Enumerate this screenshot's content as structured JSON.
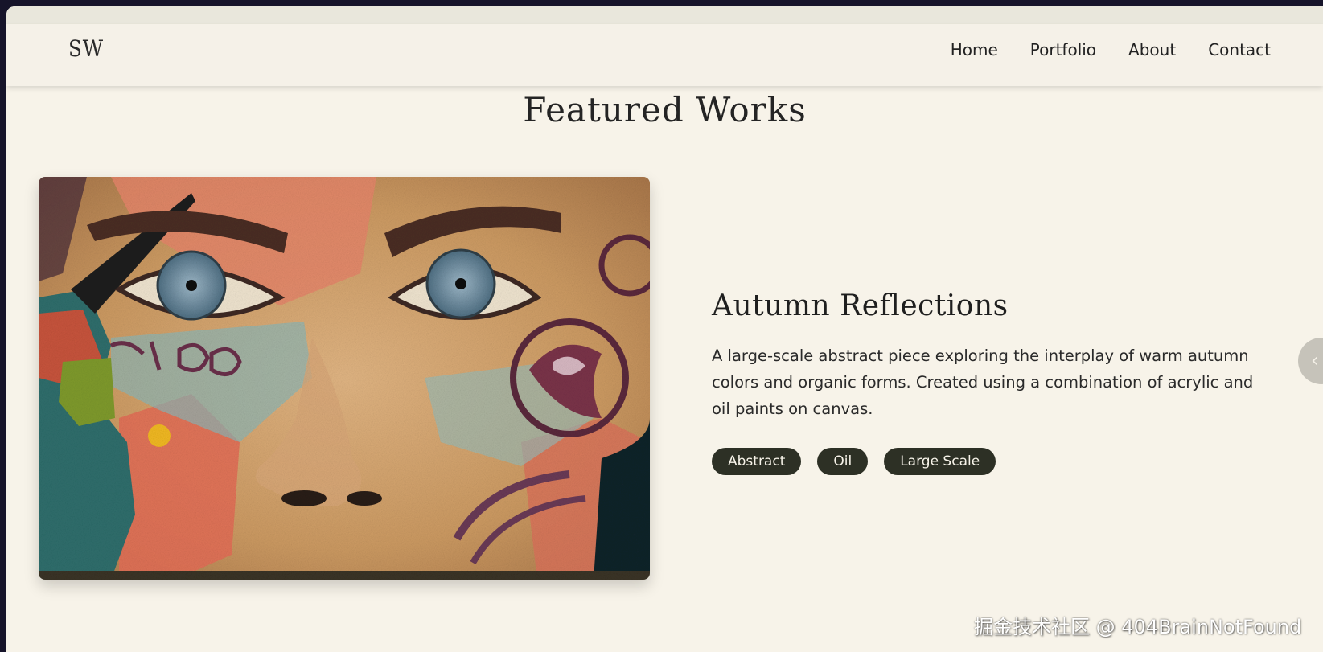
{
  "nav": {
    "logo": "SW",
    "links": [
      "Home",
      "Portfolio",
      "About",
      "Contact"
    ]
  },
  "section": {
    "title": "Featured Works"
  },
  "artwork": {
    "title": "Autumn Reflections",
    "description": "A large-scale abstract piece exploring the interplay of warm autumn colors and organic forms. Created using a combination of acrylic and oil paints on canvas.",
    "tags": [
      "Abstract",
      "Oil",
      "Large Scale"
    ],
    "image": "street-art-face-mural"
  },
  "carousel": {
    "next_icon": "chevron-left-icon",
    "next_glyph": "‹"
  },
  "watermark": "掘金技术社区 @ 404BrainNotFound",
  "colors": {
    "background": "#f7f3e9",
    "tag_bg": "#2d3025",
    "text": "#222222"
  }
}
